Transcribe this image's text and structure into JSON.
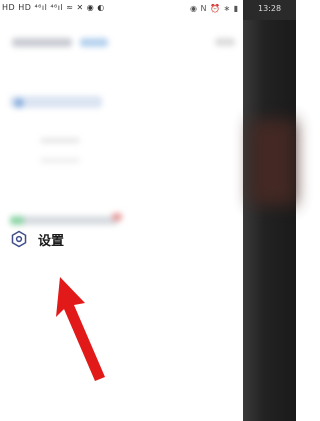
{
  "status_bar": {
    "left_indicators": "HD HD ⁴⁶ıl ⁴⁶ıl ≈ ✕ ◉ ◐",
    "right_indicators": "◉ N ⏰ ∗ ▮",
    "time": "13:28"
  },
  "drawer": {
    "settings_item": {
      "label": "设置",
      "icon": "gear-icon"
    }
  },
  "colors": {
    "arrow": "#e11919",
    "overlay": "#222222",
    "gear": "#3f4d8a"
  }
}
